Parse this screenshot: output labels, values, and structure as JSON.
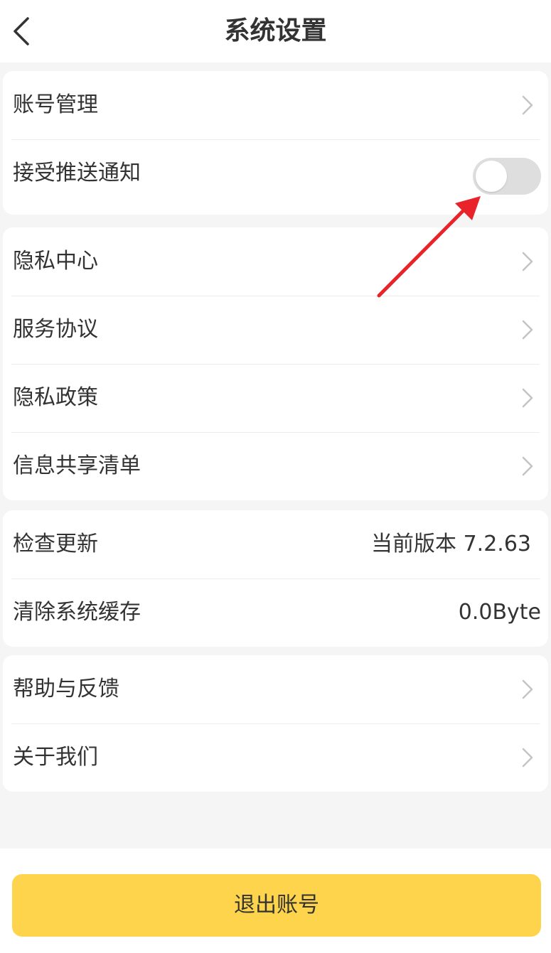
{
  "header": {
    "title": "系统设置",
    "back_icon": "chevron-left-icon"
  },
  "groups": {
    "account": {
      "account_management": "账号管理",
      "push_notifications": "接受推送通知",
      "push_enabled": false
    },
    "legal": {
      "privacy_center": "隐私中心",
      "service_agreement": "服务协议",
      "privacy_policy": "隐私政策",
      "info_sharing_list": "信息共享清单"
    },
    "system": {
      "check_update": "检查更新",
      "current_version": "当前版本 7.2.63",
      "clear_cache": "清除系统缓存",
      "cache_size": "0.0Byte"
    },
    "support": {
      "help_feedback": "帮助与反馈",
      "about_us": "关于我们"
    }
  },
  "footer": {
    "logout_label": "退出账号"
  },
  "colors": {
    "accent": "#fdd44b",
    "annotation_arrow": "#e8242a",
    "toggle_off": "#dedede"
  }
}
